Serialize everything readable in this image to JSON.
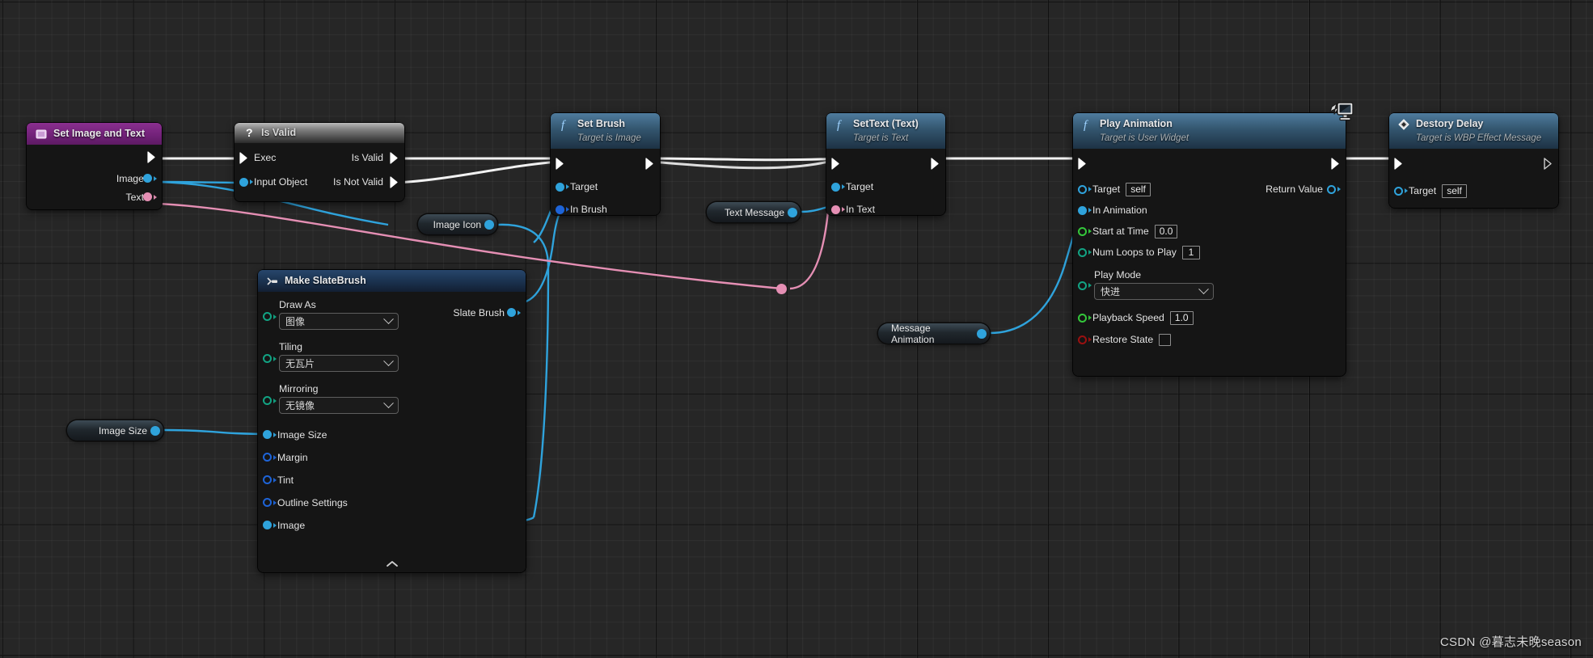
{
  "graph": {
    "watermark": "CSDN @暮志未晚season",
    "net_icon_name": "multicast-replication-icon"
  },
  "nodes": {
    "set_image_and_text": {
      "title": "Set Image and Text",
      "icon": "event-custom-icon",
      "pins": {
        "exec_out": "",
        "image": "Image",
        "text": "Text"
      }
    },
    "is_valid": {
      "title": "Is Valid",
      "icon": "question-mark-icon",
      "pins": {
        "exec_in": "Exec",
        "input_object": "Input Object",
        "is_valid": "Is Valid",
        "is_not_valid": "Is Not Valid"
      }
    },
    "set_brush": {
      "title": "Set Brush",
      "subtitle": "Target is Image",
      "icon": "function-f-icon",
      "pins": {
        "target": "Target",
        "in_brush": "In Brush"
      }
    },
    "set_text": {
      "title": "SetText (Text)",
      "subtitle": "Target is Text",
      "icon": "function-f-icon",
      "pins": {
        "target": "Target",
        "in_text": "In Text"
      }
    },
    "play_animation": {
      "title": "Play Animation",
      "subtitle": "Target is User Widget",
      "icon": "function-f-icon",
      "pins": {
        "target": "Target",
        "target_value": "self",
        "in_animation": "In Animation",
        "start_at_time": "Start at Time",
        "start_at_time_value": "0.0",
        "num_loops": "Num Loops to Play",
        "num_loops_value": "1",
        "play_mode": "Play Mode",
        "play_mode_value": "快进",
        "playback_speed": "Playback Speed",
        "playback_speed_value": "1.0",
        "restore_state": "Restore State",
        "return_value": "Return Value"
      }
    },
    "destory_delay": {
      "title": "Destory Delay",
      "subtitle": "Target is WBP Effect Message",
      "icon": "event-diamond-icon",
      "pins": {
        "target": "Target",
        "target_value": "self"
      }
    },
    "make_slatebrush": {
      "title": "Make SlateBrush",
      "icon": "make-struct-icon",
      "pins": {
        "draw_as": "Draw As",
        "draw_as_value": "图像",
        "tiling": "Tiling",
        "tiling_value": "无瓦片",
        "mirroring": "Mirroring",
        "mirroring_value": "无镜像",
        "image_size": "Image Size",
        "margin": "Margin",
        "tint": "Tint",
        "outline_settings": "Outline Settings",
        "image": "Image",
        "slate_brush": "Slate Brush",
        "collapse": "⌃"
      }
    }
  },
  "knots": [
    {
      "label": "Image Icon"
    },
    {
      "label": "Text Message"
    },
    {
      "label": "Image Size"
    },
    {
      "label": "Message Animation"
    }
  ],
  "colors": {
    "exec_white": "#ffffff",
    "object_blue": "#30a8e0",
    "text_pink": "#e58fb4",
    "struct_blue": "#1e64d8",
    "struct_teal": "#12a383",
    "float_green": "#34c73b",
    "bool_red": "#9a1010",
    "bool_bright": "#c40000",
    "header_function": "#33556e",
    "header_event": "#73227a",
    "header_gray": "#848484"
  }
}
